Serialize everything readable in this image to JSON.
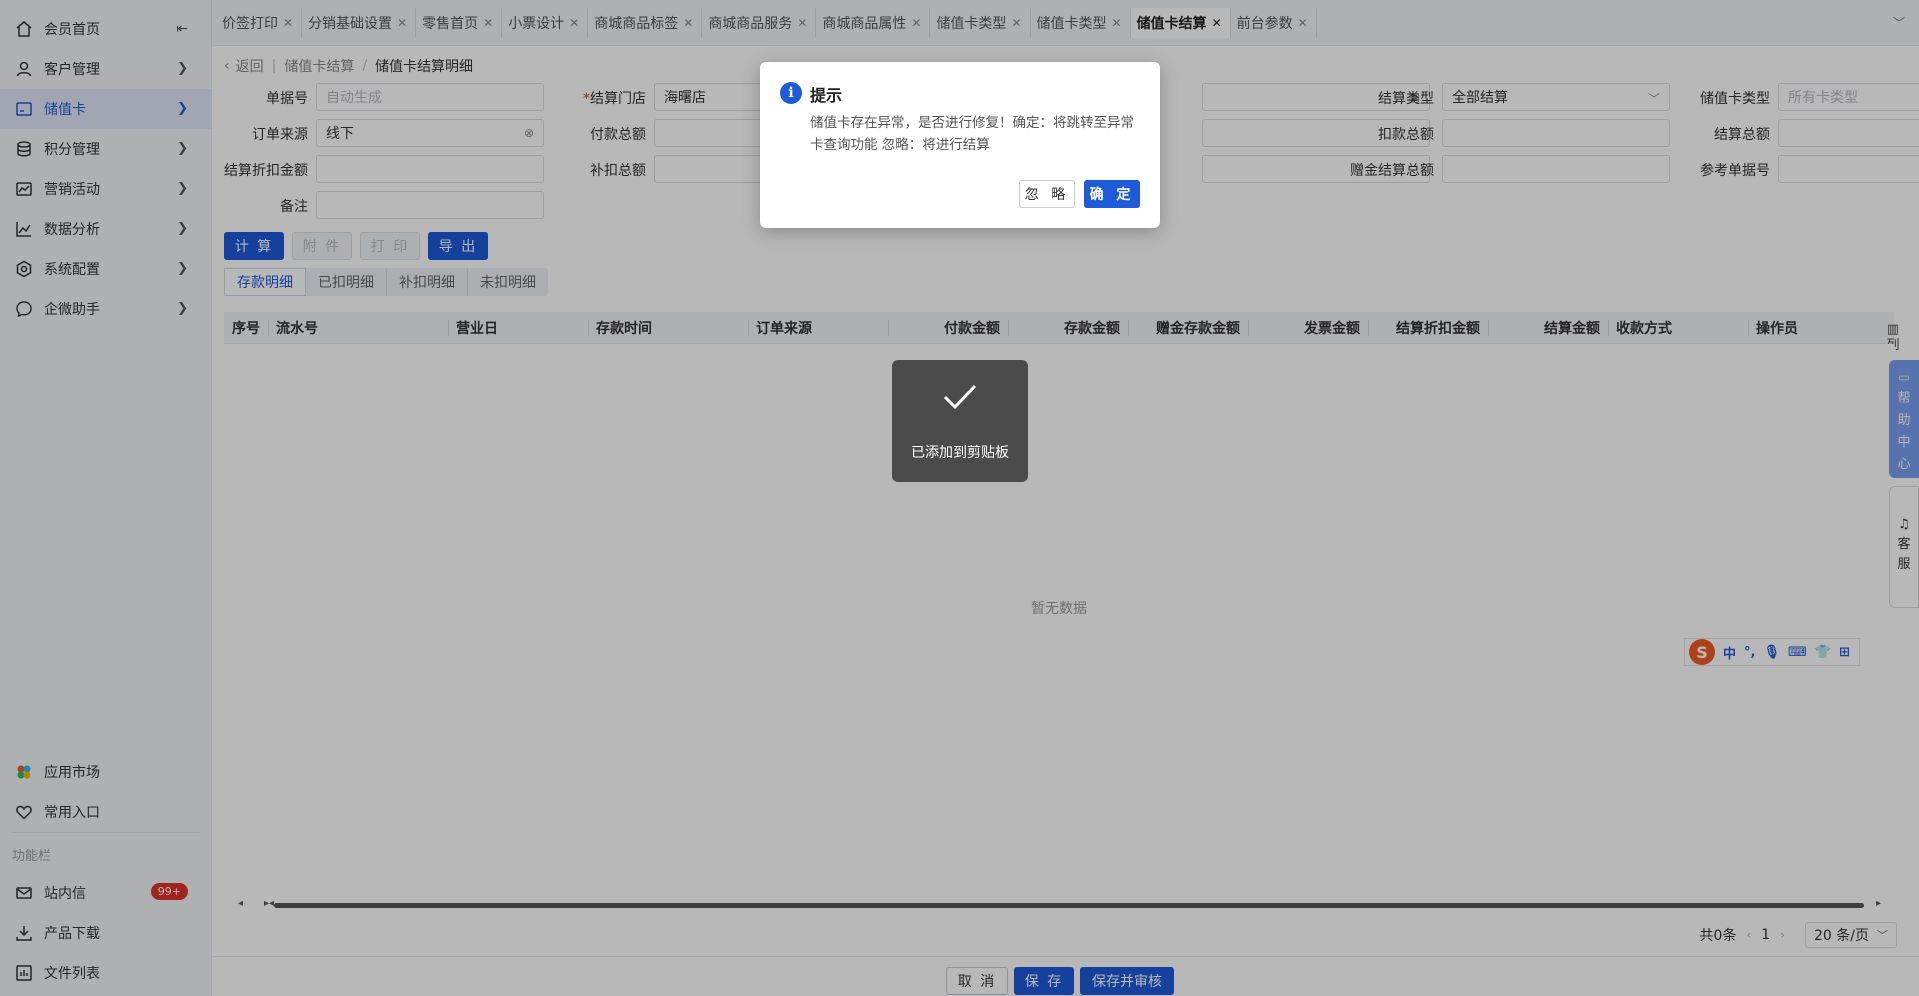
{
  "sidebar": {
    "items": [
      {
        "label": "会员首页",
        "icon": "home-icon"
      },
      {
        "label": "客户管理",
        "icon": "user-icon"
      },
      {
        "label": "储值卡",
        "icon": "card-icon"
      },
      {
        "label": "积分管理",
        "icon": "database-icon"
      },
      {
        "label": "营销活动",
        "icon": "chart-box-icon"
      },
      {
        "label": "数据分析",
        "icon": "trend-icon"
      },
      {
        "label": "系统配置",
        "icon": "settings-icon"
      },
      {
        "label": "企微助手",
        "icon": "chat-icon"
      }
    ],
    "bottom_items": [
      {
        "label": "应用市场",
        "icon": "app-market-icon"
      },
      {
        "label": "常用入口",
        "icon": "heart-icon"
      }
    ],
    "caption": "功能栏",
    "func_items": [
      {
        "label": "站内信",
        "icon": "mail-icon",
        "badge": "99+"
      },
      {
        "label": "产品下载",
        "icon": "download-icon"
      },
      {
        "label": "文件列表",
        "icon": "file-list-icon"
      }
    ]
  },
  "tabs": [
    {
      "label": "价签打印"
    },
    {
      "label": "分销基础设置"
    },
    {
      "label": "零售首页"
    },
    {
      "label": "小票设计"
    },
    {
      "label": "商城商品标签"
    },
    {
      "label": "商城商品服务"
    },
    {
      "label": "商城商品属性"
    },
    {
      "label": "储值卡类型"
    },
    {
      "label": "储值卡类型"
    },
    {
      "label": "储值卡结算"
    },
    {
      "label": "前台参数"
    }
  ],
  "breadcrumb": {
    "back": "返回",
    "parent": "储值卡结算",
    "current": "储值卡结算明细"
  },
  "form": {
    "doc_no": {
      "label": "单据号",
      "placeholder": "自动生成"
    },
    "store": {
      "label": "结算门店",
      "value": "海曙店"
    },
    "settle_type": {
      "label": "结算类型",
      "value": "全部结算"
    },
    "card_type": {
      "label": "储值卡类型",
      "placeholder": "所有卡类型"
    },
    "order_source": {
      "label": "订单来源",
      "value": "线下"
    },
    "pay_total": {
      "label": "付款总额"
    },
    "deduct_total": {
      "label": "扣款总额"
    },
    "settle_total": {
      "label": "结算总额"
    },
    "discount_amount": {
      "label": "结算折扣金额"
    },
    "supplement_total": {
      "label": "补扣总额"
    },
    "gift_settle_total": {
      "label": "赠金结算总额"
    },
    "ref_no": {
      "label": "参考单据号"
    },
    "remark": {
      "label": "备注"
    }
  },
  "actions": {
    "calc": "计 算",
    "attach": "附 件",
    "print": "打 印",
    "export": "导 出"
  },
  "subtabs": [
    "存款明细",
    "已扣明细",
    "补扣明细",
    "未扣明细"
  ],
  "table": {
    "columns": [
      "序号",
      "流水号",
      "营业日",
      "存款时间",
      "订单来源",
      "付款金额",
      "存款金额",
      "赠金存款金额",
      "发票金额",
      "结算折扣金额",
      "结算金额",
      "收款方式",
      "操作员"
    ],
    "empty_text": "暂无数据",
    "column_button": "列"
  },
  "pagination": {
    "total": "共0条",
    "page": "1",
    "page_size": "20 条/页"
  },
  "footer": {
    "cancel": "取 消",
    "save": "保 存",
    "save_audit": "保存并审核"
  },
  "floats": {
    "help": [
      "帮",
      "助",
      "中",
      "心"
    ],
    "service": [
      "客",
      "服"
    ]
  },
  "ime": {
    "logo": "S",
    "mode": "中"
  },
  "dialog": {
    "title": "提示",
    "message": "储值卡存在异常，是否进行修复！确定：将跳转至异常卡查询功能 忽略：将进行结算",
    "ignore": "忽 略",
    "confirm": "确 定"
  },
  "toast": {
    "text": "已添加到剪贴板"
  },
  "colors": {
    "primary": "#1e5bd9",
    "badge": "#e0312b",
    "help_float": "#7a9ef0"
  }
}
